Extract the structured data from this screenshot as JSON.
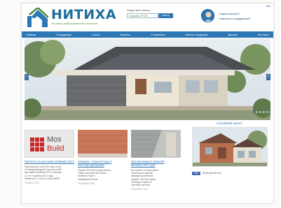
{
  "header": {
    "logo_title": "НИТИХА",
    "logo_subtitle": "поставки фиброцементных панелей",
    "search_label": "Найди свою панель",
    "search_placeholder": "Например, EFX83",
    "search_button": "искать",
    "mail_link": "Mail",
    "question_1": "Задать вопрос?",
    "question_2": "Написать сотрудникам?"
  },
  "nav": {
    "items": [
      "Главная",
      "О продукции",
      "Статьи",
      "Проекты",
      "О компании",
      "Каталог продукции",
      "Дилеры",
      "Контакты"
    ]
  },
  "hero": {
    "slide_count": 6,
    "active_slide": 1
  },
  "news": [
    {
      "image_caption_1": "Mos",
      "image_caption_2": "Build",
      "title": "NICHIHA на выставке MosBuild 2013",
      "text": [
        "Приглашаем посетить наш стенд",
        "на международной строительной",
        "выставке MosBuild 2013 в Москве",
        "с 2 по 5 апреля 2013 года.",
        "Павильон 2, зал 8, стенд B4089"
      ],
      "date": "29 марта 2013"
    },
    {
      "title": "Новинка - панели Fuge в",
      "title_2": "системе крепления",
      "text": [
        "Фирма NICHIHA представляет",
        "новую систему крепления",
        "панелей Fuge с",
        "невидимым швом."
      ],
      "date": "11 декабря 2012"
    },
    {
      "title": "Использование панелей",
      "title_2": "NICHIHA NFT для",
      "text": [
        "Вы можете использовать",
        "панели для отделки",
        "фасадов различных",
        "зданий: частные дома,",
        "коттеджи, офисы и",
        "торговые центры."
      ],
      "date": "05 декабря 2012"
    }
  ],
  "random_project": {
    "title": "Случайный проект:",
    "like_label": "Like",
    "like_text": "96 people like this"
  },
  "colors": {
    "brand_blue": "#2e77b5",
    "brand_green": "#4a8a3a",
    "mos_red": "#c62828"
  }
}
